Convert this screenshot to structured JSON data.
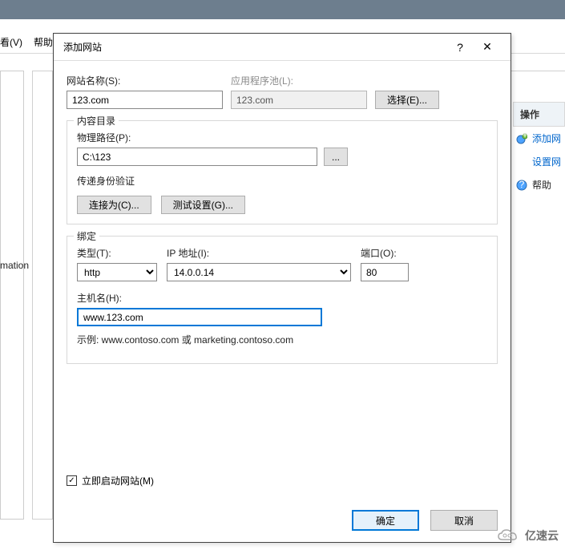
{
  "menubar": {
    "item1": "看(V)",
    "item2": "帮助(H)"
  },
  "left": {
    "label": "mation S"
  },
  "dialog": {
    "title": "添加网站",
    "help_symbol": "?",
    "close_symbol": "✕",
    "site_name_label": "网站名称(S):",
    "site_name_value": "123.com",
    "app_pool_label": "应用程序池(L):",
    "app_pool_value": "123.com",
    "select_btn": "选择(E)...",
    "content_dir_group": "内容目录",
    "physical_path_label": "物理路径(P):",
    "physical_path_value": "C:\\123",
    "browse_btn": "...",
    "pass_auth_label": "传递身份验证",
    "connect_as_btn": "连接为(C)...",
    "test_settings_btn": "测试设置(G)...",
    "binding_group": "绑定",
    "type_label": "类型(T):",
    "type_value": "http",
    "ip_label": "IP 地址(I):",
    "ip_value": "14.0.0.14",
    "port_label": "端口(O):",
    "port_value": "80",
    "host_label": "主机名(H):",
    "host_value": "www.123.com",
    "example_text": "示例: www.contoso.com 或 marketing.contoso.com",
    "start_now_checked": "✓",
    "start_now_label": "立即启动网站(M)",
    "ok_btn": "确定",
    "cancel_btn": "取消"
  },
  "right": {
    "header": "操作",
    "add_site": "添加网",
    "set_site": "设置网",
    "help": "帮助"
  },
  "watermark": {
    "text": "亿速云"
  }
}
